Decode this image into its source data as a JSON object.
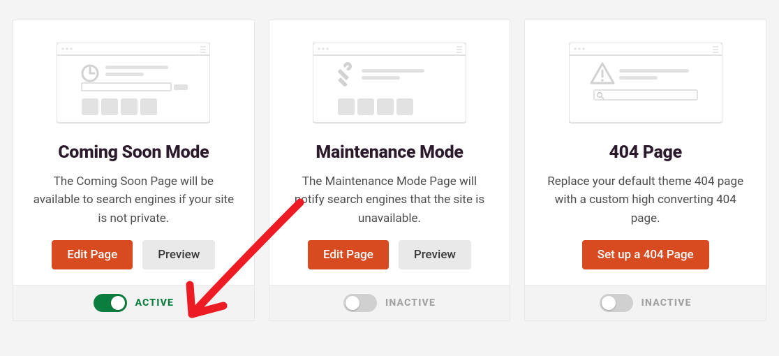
{
  "cards": [
    {
      "title": "Coming Soon Mode",
      "desc": "The Coming Soon Page will be available to search engines if your site is not private.",
      "primary": "Edit Page",
      "secondary": "Preview",
      "status": "ACTIVE",
      "active": true,
      "icon": "clock"
    },
    {
      "title": "Maintenance Mode",
      "desc": "The Maintenance Mode Page will notify search engines that the site is unavailable.",
      "primary": "Edit Page",
      "secondary": "Preview",
      "status": "INACTIVE",
      "active": false,
      "icon": "tools"
    },
    {
      "title": "404 Page",
      "desc": "Replace your default theme 404 page with a custom high converting 404 page.",
      "primary": "Set up a 404 Page",
      "secondary": null,
      "status": "INACTIVE",
      "active": false,
      "icon": "warning"
    }
  ]
}
